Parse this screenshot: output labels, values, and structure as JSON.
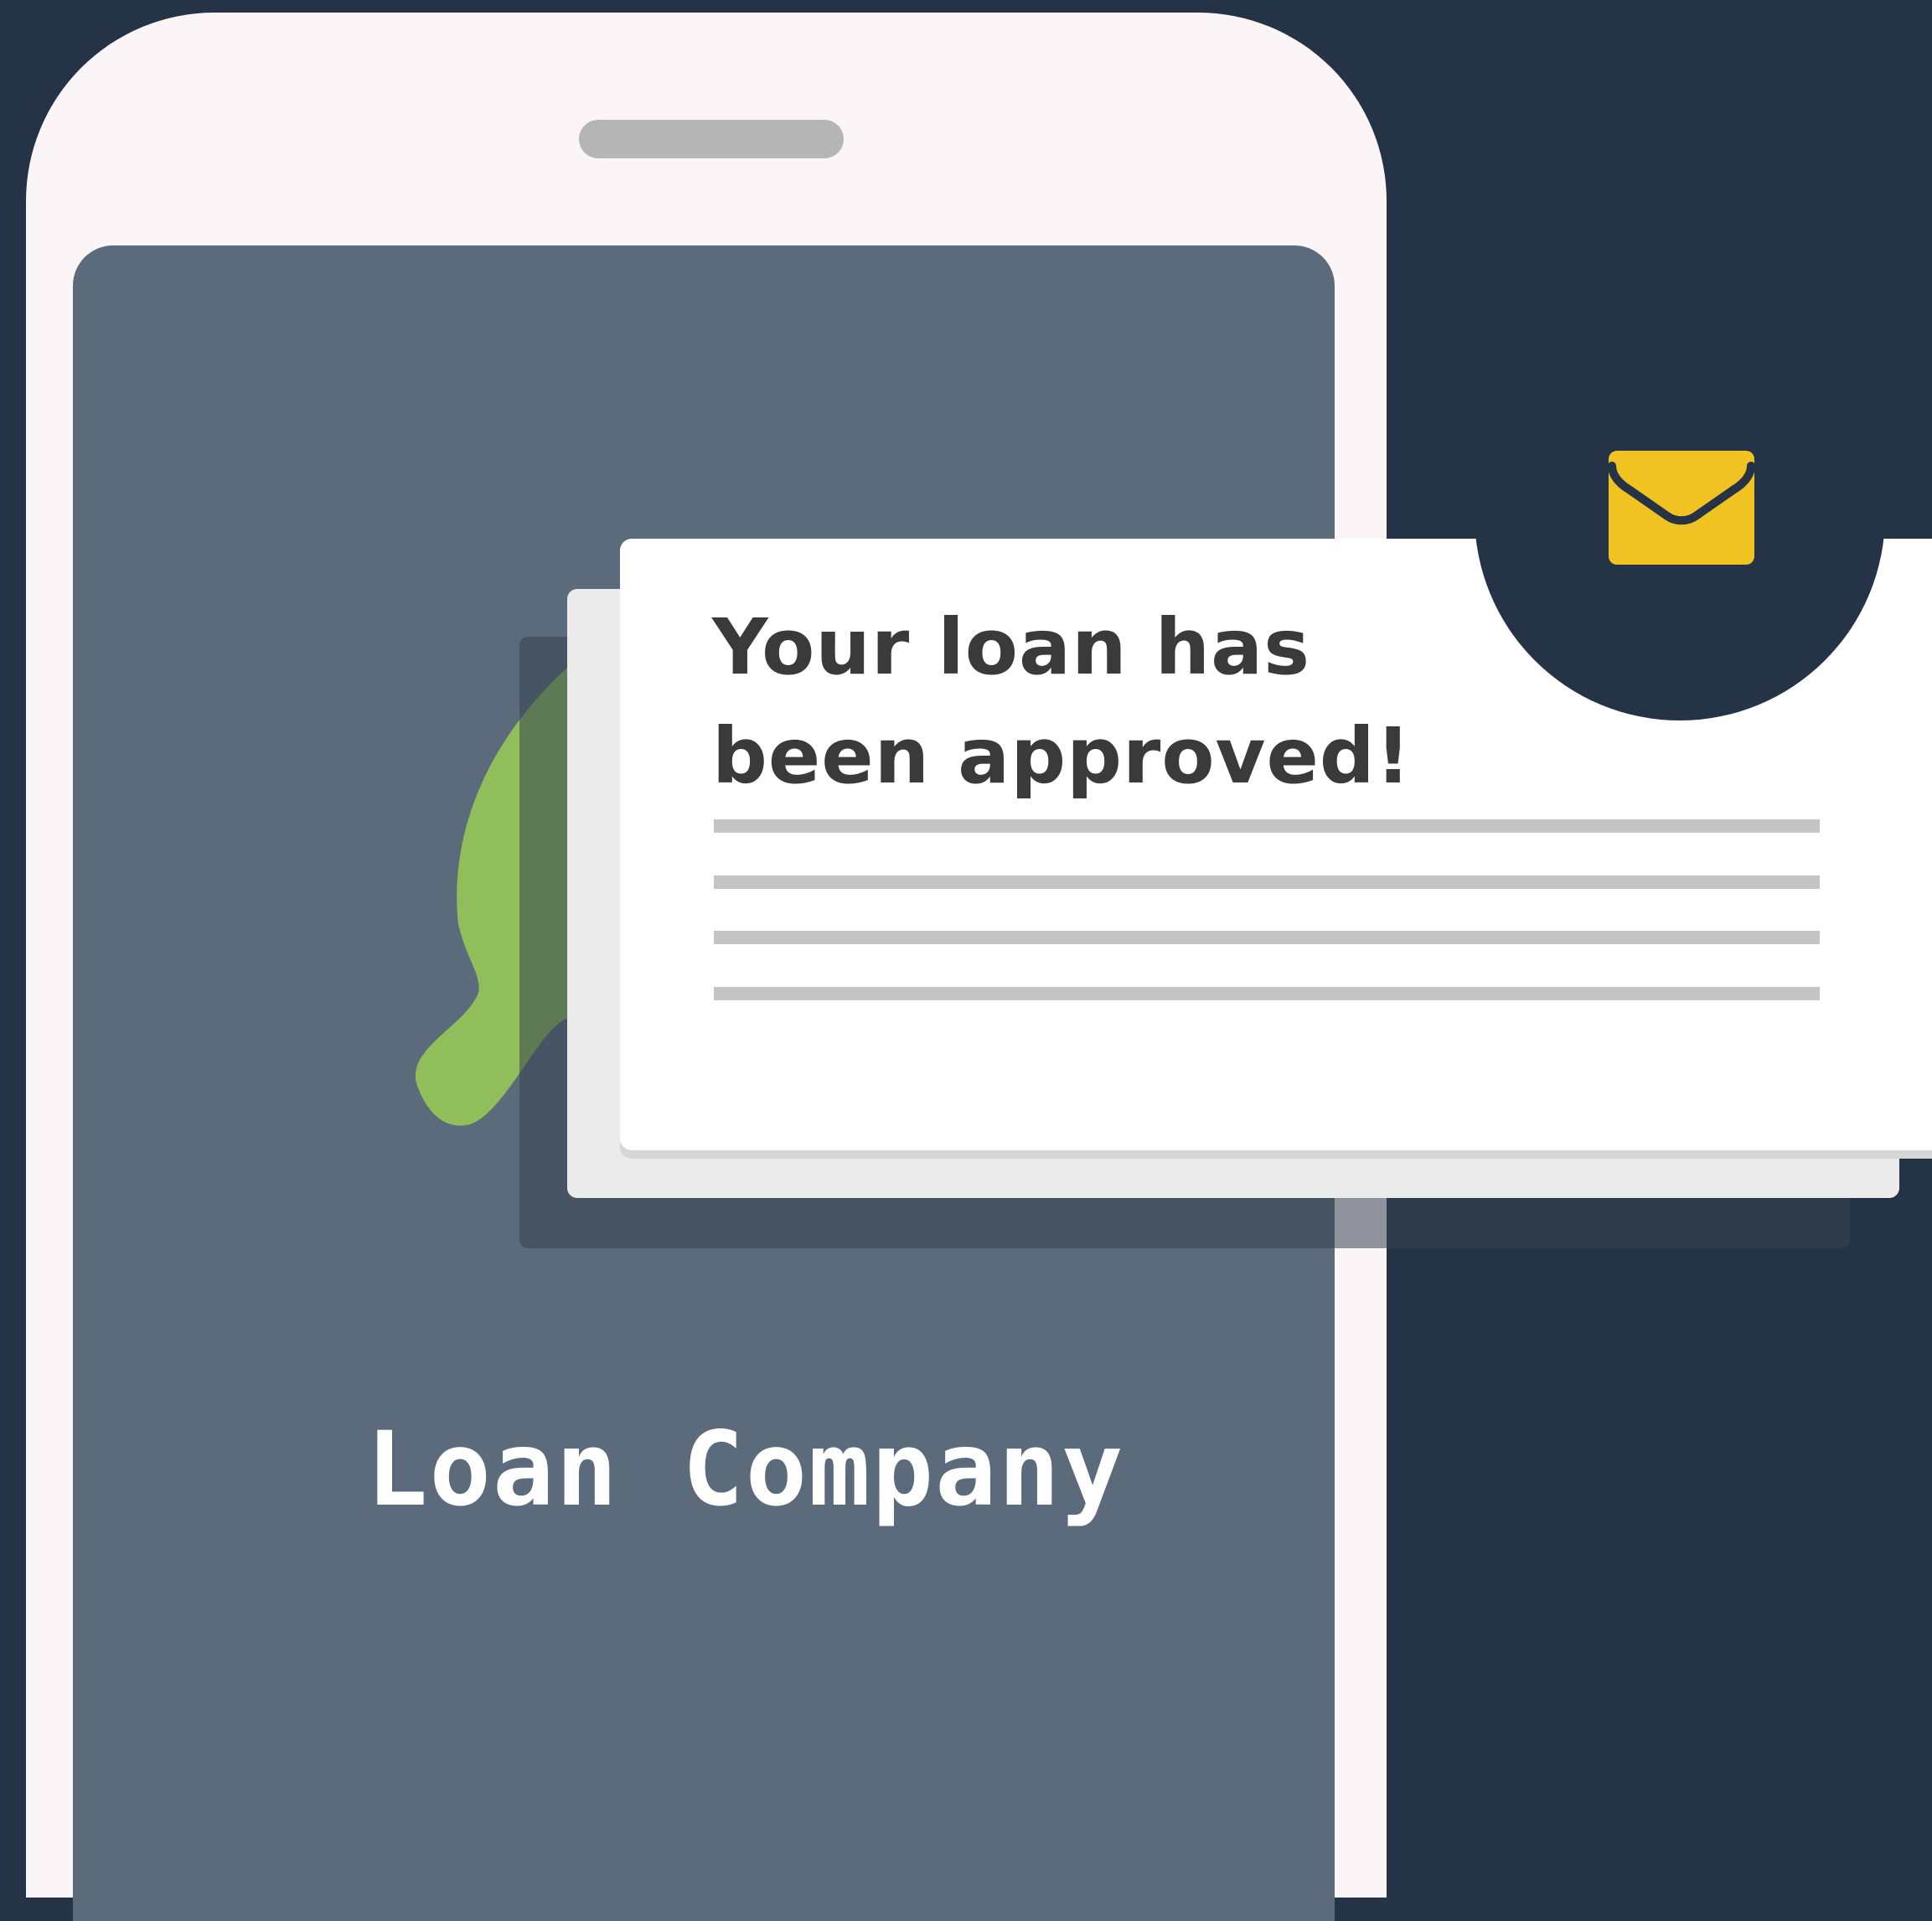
{
  "company": {
    "name": "Loan Company"
  },
  "notification": {
    "headline_line1": "Your loan has",
    "headline_line2": "been approved!",
    "body_placeholder_lines": 4
  },
  "icons": {
    "mail": "envelope-icon",
    "logo": "logo-mark"
  },
  "colors": {
    "background": "#243345",
    "phone_body": "#fcf5f7",
    "screen": "#5b6b7c",
    "logo_green": "#8fbe5a",
    "envelope": "#f0c222",
    "headline": "#3a3a3a",
    "placeholder_line": "#c4c4c4"
  }
}
